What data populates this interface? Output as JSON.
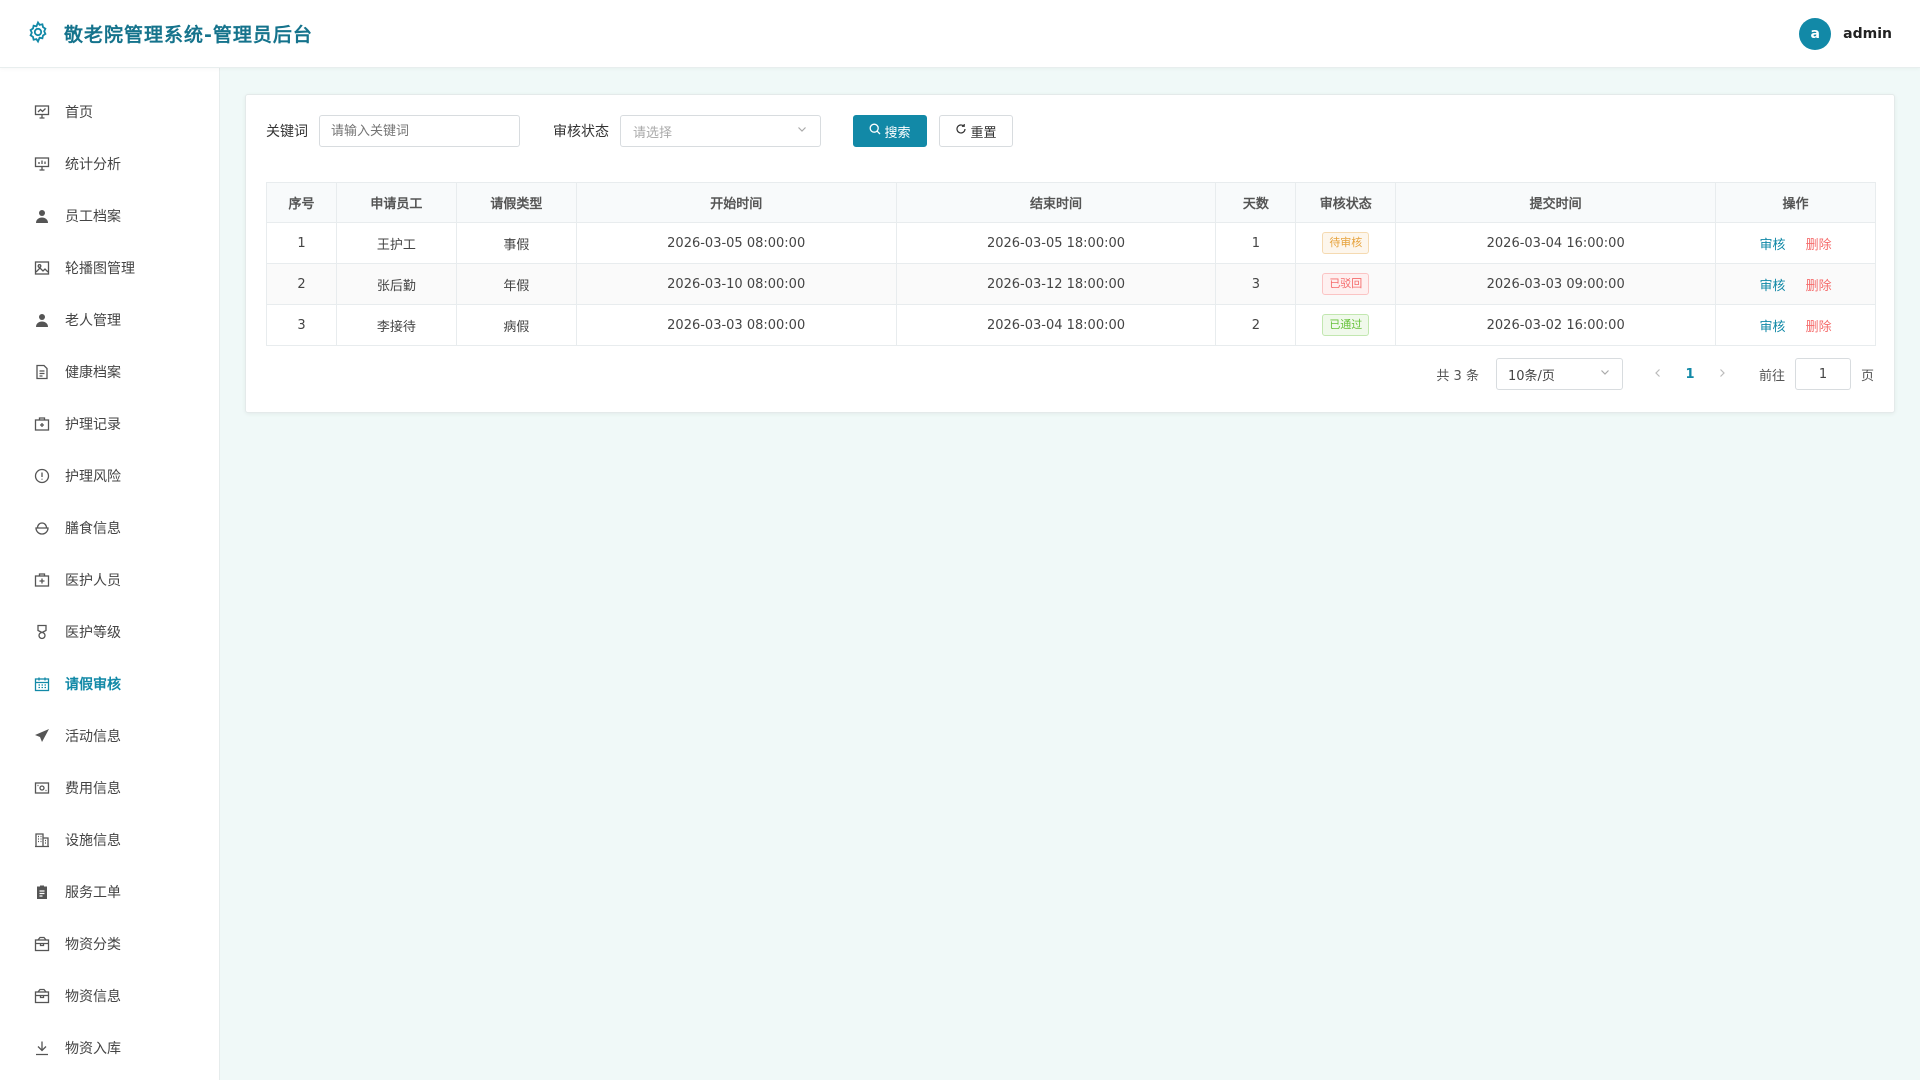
{
  "header": {
    "title": "敬老院管理系统-管理员后台",
    "avatar_letter": "a",
    "username": "admin"
  },
  "sidebar": {
    "items": [
      {
        "label": "首页",
        "icon": "presentation-icon"
      },
      {
        "label": "统计分析",
        "icon": "chart-board-icon"
      },
      {
        "label": "员工档案",
        "icon": "user-icon"
      },
      {
        "label": "轮播图管理",
        "icon": "image-icon"
      },
      {
        "label": "老人管理",
        "icon": "user-icon"
      },
      {
        "label": "健康档案",
        "icon": "document-icon"
      },
      {
        "label": "护理记录",
        "icon": "medical-box-icon"
      },
      {
        "label": "护理风险",
        "icon": "warning-circle-icon"
      },
      {
        "label": "膳食信息",
        "icon": "food-bowl-icon"
      },
      {
        "label": "医护人员",
        "icon": "first-aid-icon"
      },
      {
        "label": "医护等级",
        "icon": "medal-icon"
      },
      {
        "label": "请假审核",
        "icon": "calendar-icon",
        "active": true
      },
      {
        "label": "活动信息",
        "icon": "send-icon"
      },
      {
        "label": "费用信息",
        "icon": "wallet-icon"
      },
      {
        "label": "设施信息",
        "icon": "building-icon"
      },
      {
        "label": "服务工单",
        "icon": "clipboard-icon"
      },
      {
        "label": "物资分类",
        "icon": "box-icon"
      },
      {
        "label": "物资信息",
        "icon": "box-icon"
      },
      {
        "label": "物资入库",
        "icon": "download-icon"
      }
    ]
  },
  "filters": {
    "keyword_label": "关键词",
    "keyword_placeholder": "请输入关键词",
    "status_label": "审核状态",
    "status_placeholder": "请选择",
    "search_label": "搜索",
    "reset_label": "重置"
  },
  "table": {
    "headers": [
      "序号",
      "申请员工",
      "请假类型",
      "开始时间",
      "结束时间",
      "天数",
      "审核状态",
      "提交时间",
      "操作"
    ],
    "rows": [
      {
        "no": "1",
        "employee": "王护工",
        "type": "事假",
        "start": "2026-03-05 08:00:00",
        "end": "2026-03-05 18:00:00",
        "days": "1",
        "status": "待审核",
        "submitted": "2026-03-04 16:00:00"
      },
      {
        "no": "2",
        "employee": "张后勤",
        "type": "年假",
        "start": "2026-03-10 08:00:00",
        "end": "2026-03-12 18:00:00",
        "days": "3",
        "status": "已驳回",
        "submitted": "2026-03-03 09:00:00"
      },
      {
        "no": "3",
        "employee": "李接待",
        "type": "病假",
        "start": "2026-03-03 08:00:00",
        "end": "2026-03-04 18:00:00",
        "days": "2",
        "status": "已通过",
        "submitted": "2026-03-02 16:00:00"
      }
    ],
    "action_audit": "审核",
    "action_delete": "删除"
  },
  "pagination": {
    "total_text": "共 3 条",
    "page_size": "10条/页",
    "current_page": "1",
    "goto_label": "前往",
    "goto_value": "1",
    "page_suffix": "页"
  },
  "colors": {
    "primary": "#1289a7",
    "danger": "#f56c6c",
    "warning": "#e6a23c",
    "success": "#67c23a"
  }
}
